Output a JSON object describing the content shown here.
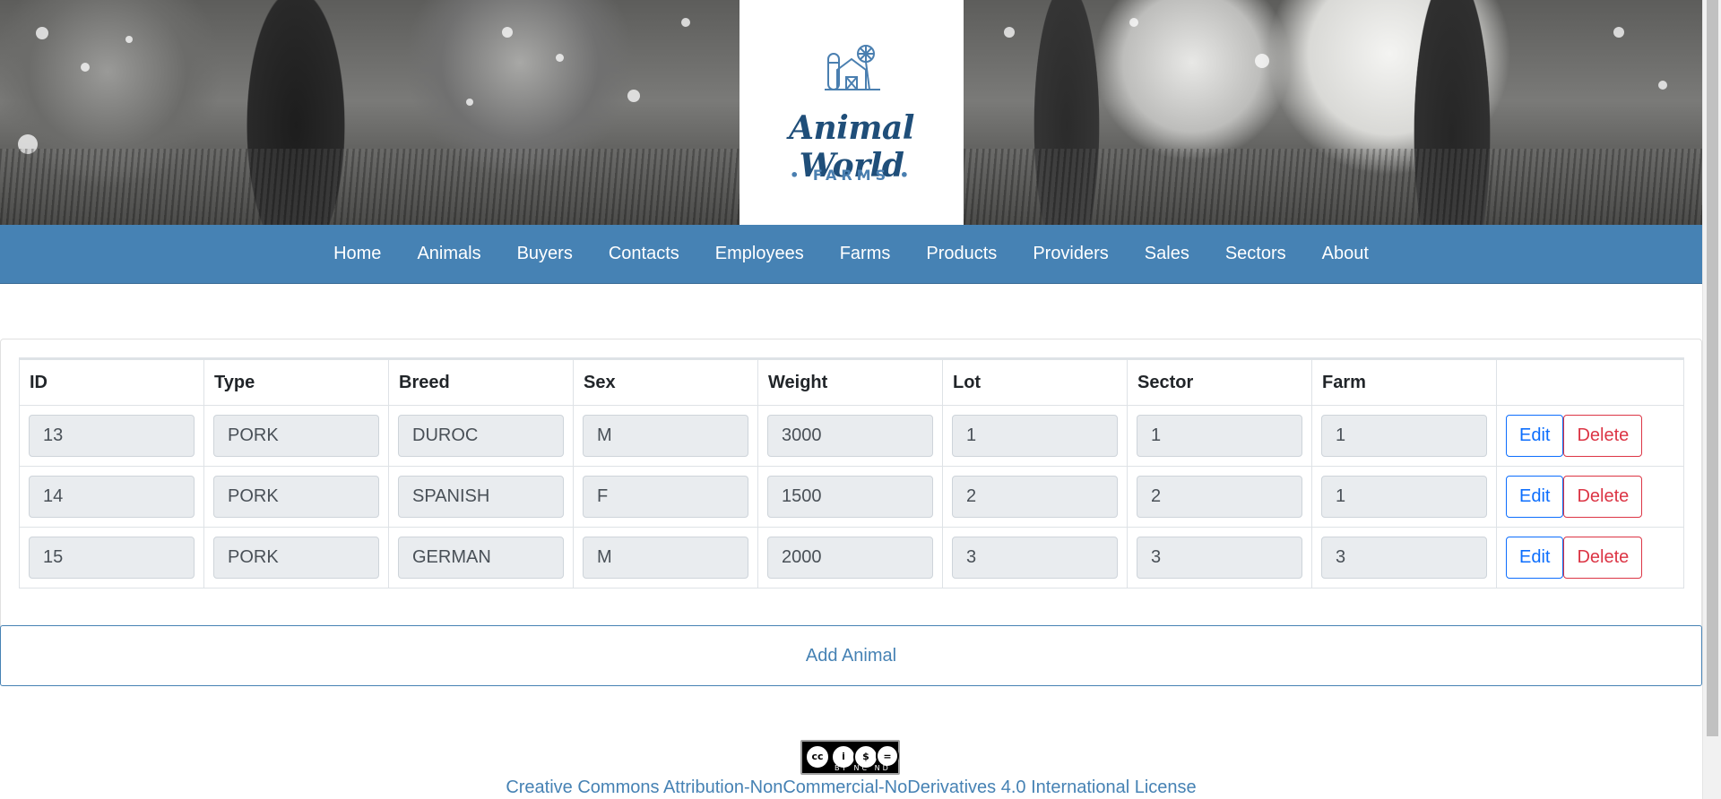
{
  "logo": {
    "title": "Animal World",
    "subtitle": "• FARMS •"
  },
  "nav": {
    "items": [
      {
        "label": "Home"
      },
      {
        "label": "Animals"
      },
      {
        "label": "Buyers"
      },
      {
        "label": "Contacts"
      },
      {
        "label": "Employees"
      },
      {
        "label": "Farms"
      },
      {
        "label": "Products"
      },
      {
        "label": "Providers"
      },
      {
        "label": "Sales"
      },
      {
        "label": "Sectors"
      },
      {
        "label": "About"
      }
    ]
  },
  "table": {
    "columns": [
      "ID",
      "Type",
      "Breed",
      "Sex",
      "Weight",
      "Lot",
      "Sector",
      "Farm"
    ],
    "rows": [
      {
        "id": "13",
        "type": "PORK",
        "breed": "DUROC",
        "sex": "M",
        "weight": "3000",
        "lot": "1",
        "sector": "1",
        "farm": "1"
      },
      {
        "id": "14",
        "type": "PORK",
        "breed": "SPANISH",
        "sex": "F",
        "weight": "1500",
        "lot": "2",
        "sector": "2",
        "farm": "1"
      },
      {
        "id": "15",
        "type": "PORK",
        "breed": "GERMAN",
        "sex": "M",
        "weight": "2000",
        "lot": "3",
        "sector": "3",
        "farm": "3"
      }
    ],
    "edit_label": "Edit",
    "delete_label": "Delete"
  },
  "add_button_label": "Add Animal",
  "footer": {
    "badge_text": "BY NC ND",
    "license_text": "Creative Commons Attribution-NonCommercial-NoDerivatives 4.0 International License"
  },
  "colors": {
    "navbar": "#4682b4",
    "edit": "#0d6efd",
    "delete": "#dc3545",
    "logo_text": "#1f4e79"
  }
}
